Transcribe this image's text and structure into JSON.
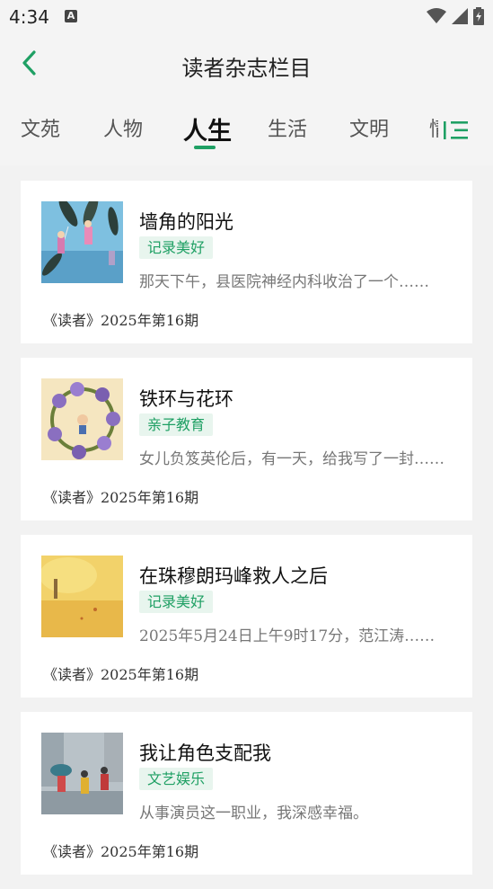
{
  "status_bar": {
    "time": "4:34",
    "notification_icon": "a-icon",
    "icons": [
      "wifi-icon",
      "signal-icon",
      "battery-icon"
    ]
  },
  "header": {
    "title": "读者杂志栏目",
    "back_icon": "chevron-left-icon"
  },
  "tabs": {
    "items": [
      {
        "label": "文苑",
        "active": false
      },
      {
        "label": "人物",
        "active": false
      },
      {
        "label": "人生",
        "active": true
      },
      {
        "label": "生活",
        "active": false
      },
      {
        "label": "文明",
        "active": false
      }
    ],
    "partial_next": "情",
    "menu_icon": "list-menu-icon",
    "accent_color": "#1fa064"
  },
  "articles": [
    {
      "title": "墙角的阳光",
      "tag": "记录美好",
      "summary": "那天下午，县医院神经内科收治了一个……",
      "source": "《读者》2025年第16期",
      "thumb_icon": "kite-illustration-thumbnail"
    },
    {
      "title": "铁环与花环",
      "tag": "亲子教育",
      "summary": "女儿负笈英伦后，有一天，给我写了一封……",
      "source": "《读者》2025年第16期",
      "thumb_icon": "flower-wreath-illustration-thumbnail"
    },
    {
      "title": "在珠穆朗玛峰救人之后",
      "tag": "记录美好",
      "summary": "2025年5月24日上午9时17分，范江涛……",
      "source": "《读者》2025年第16期",
      "thumb_icon": "golden-tree-illustration-thumbnail"
    },
    {
      "title": "我让角色支配我",
      "tag": "文艺娱乐",
      "summary": "从事演员这一职业，我深感幸福。",
      "source": "《读者》2025年第16期",
      "thumb_icon": "rainy-street-illustration-thumbnail"
    }
  ]
}
